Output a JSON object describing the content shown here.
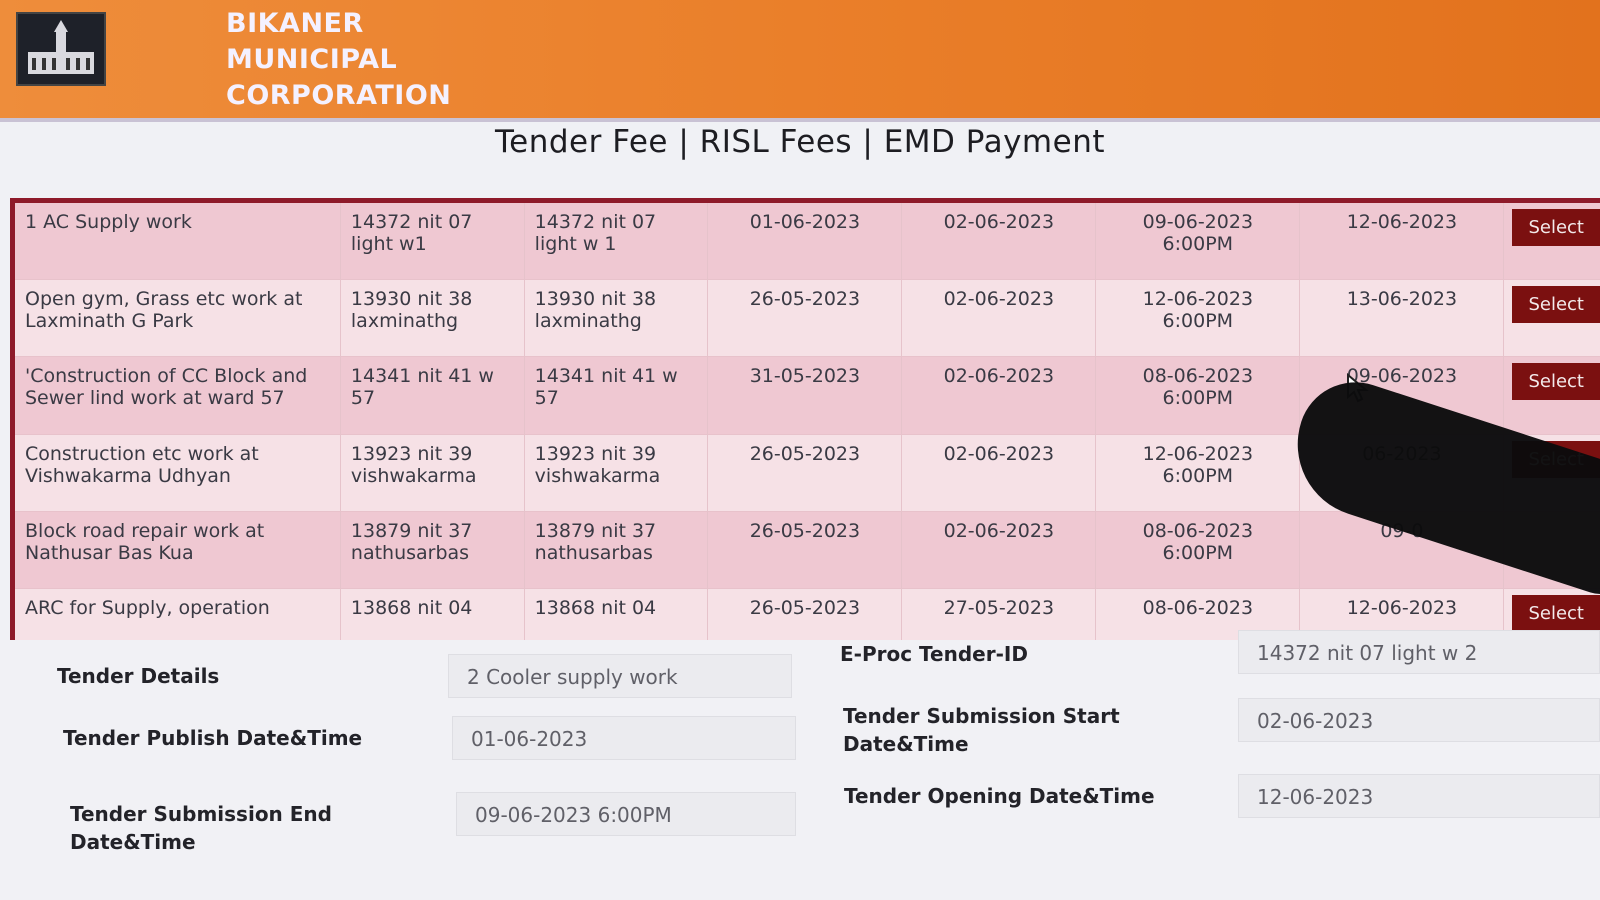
{
  "header": {
    "org_line1": "BIKANER",
    "org_line2": "MUNICIPAL",
    "org_line3": "CORPORATION"
  },
  "page": {
    "heading": "Tender Fee | RISL Fees | EMD Payment"
  },
  "table": {
    "rows": [
      {
        "name": "1 AC Supply work",
        "id1": "14372 nit 07 light w1",
        "id2": "14372 nit 07 light w 1",
        "publish": "01-06-2023",
        "start": "02-06-2023",
        "end": "09-06-2023 6:00PM",
        "open": "12-06-2023",
        "action": "Select"
      },
      {
        "name": "Open gym, Grass etc work at Laxminath G Park",
        "id1": "13930 nit 38 laxminathg",
        "id2": "13930 nit 38 laxminathg",
        "publish": "26-05-2023",
        "start": "02-06-2023",
        "end": "12-06-2023 6:00PM",
        "open": "13-06-2023",
        "action": "Select"
      },
      {
        "name": "'Construction of CC Block and Sewer lind work at ward 57",
        "id1": "14341 nit 41 w 57",
        "id2": "14341 nit 41 w 57",
        "publish": "31-05-2023",
        "start": "02-06-2023",
        "end": "08-06-2023 6:00PM",
        "open": "09-06-2023",
        "action": "Select"
      },
      {
        "name": "Construction etc work at Vishwakarma Udhyan",
        "id1": "13923 nit 39 vishwakarma",
        "id2": "13923 nit 39 vishwakarma",
        "publish": "26-05-2023",
        "start": "02-06-2023",
        "end": "12-06-2023 6:00PM",
        "open": "06-2023",
        "action": "Select"
      },
      {
        "name": "Block road repair work at Nathusar Bas Kua",
        "id1": "13879 nit 37 nathusarbas",
        "id2": "13879 nit 37 nathusarbas",
        "publish": "26-05-2023",
        "start": "02-06-2023",
        "end": "08-06-2023 6:00PM",
        "open": "09-0",
        "action": ""
      },
      {
        "name": "ARC for Supply, operation",
        "id1": "13868 nit 04",
        "id2": "13868 nit 04",
        "publish": "26-05-2023",
        "start": "27-05-2023",
        "end": "08-06-2023",
        "open": "12-06-2023",
        "action": "Select"
      }
    ]
  },
  "form": {
    "tender_details_label": "Tender Details",
    "tender_details_value": "2 Cooler supply work",
    "eproc_id_label": "E-Proc Tender-ID",
    "eproc_id_value": "14372 nit 07 light  w 2",
    "publish_label": "Tender Publish Date&Time",
    "publish_value": "01-06-2023",
    "sub_start_label_1": "Tender Submission Start",
    "sub_start_label_2": "Date&Time",
    "sub_start_value": "02-06-2023",
    "sub_end_label_1": "Tender Submission End",
    "sub_end_label_2": "Date&Time",
    "sub_end_value": "09-06-2023 6:00PM",
    "opening_label": "Tender Opening Date&Time",
    "opening_value": "12-06-2023"
  },
  "colors": {
    "header_orange": "#ea7f2a",
    "table_border": "#8e1a2a",
    "select_button": "#7b1010"
  }
}
